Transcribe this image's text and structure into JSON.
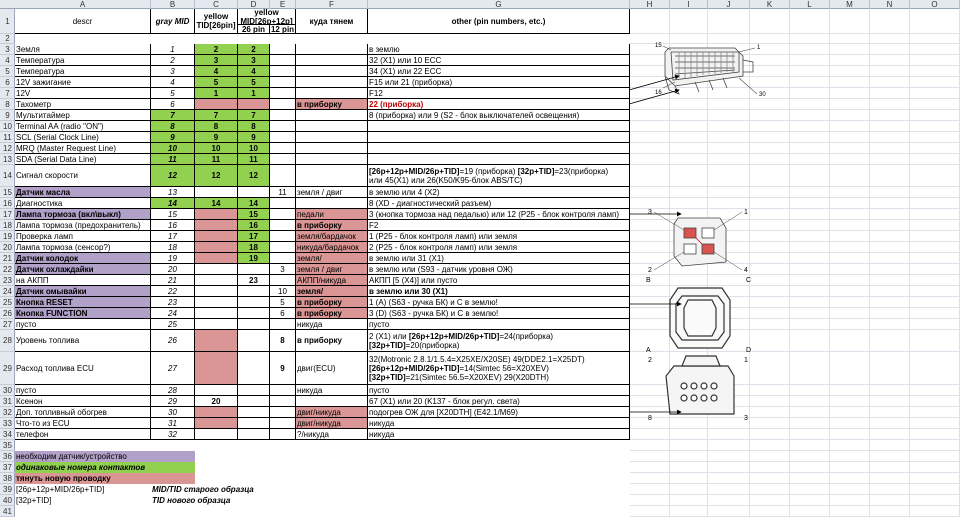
{
  "columns": [
    "A",
    "B",
    "C",
    "D",
    "E",
    "F",
    "G",
    "H",
    "I",
    "J",
    "K",
    "L",
    "M",
    "N",
    "O"
  ],
  "header": {
    "descr": "descr",
    "gray": "gray MID",
    "yellow_tid": "yellow TID[26pin]",
    "yellow_mid": "yellow MID[26p+12p]",
    "pin26": "26 pin",
    "pin12": "12 pin",
    "where": "куда тянем",
    "other": "other (pin numbers, etc.)"
  },
  "rows": [
    {
      "n": "3",
      "descr": "Земля",
      "b": "1",
      "c": "2",
      "d": "2",
      "e": "",
      "f": "",
      "g": "в землю"
    },
    {
      "n": "4",
      "descr": "Температура",
      "b": "2",
      "c": "3",
      "d": "3",
      "e": "",
      "f": "",
      "g": "32 (X1) или 10 ECC"
    },
    {
      "n": "5",
      "descr": "Температура",
      "b": "3",
      "c": "4",
      "d": "4",
      "e": "",
      "f": "",
      "g": "34 (X1) или 22 ECC"
    },
    {
      "n": "6",
      "descr": "12V зажигание",
      "b": "4",
      "c": "5",
      "d": "5",
      "e": "",
      "f": "",
      "g": "F15 или 21 (приборка)"
    },
    {
      "n": "7",
      "descr": "12V",
      "b": "5",
      "c": "1",
      "d": "1",
      "e": "",
      "f": "",
      "g": "F12"
    },
    {
      "n": "8",
      "descr": "Тахометр",
      "b": "6",
      "c": "",
      "d": "",
      "e": "",
      "f": "в приборку",
      "g": "22 (приборка)"
    },
    {
      "n": "9",
      "descr": "Мультитаймер",
      "b": "7",
      "c": "7",
      "d": "7",
      "e": "",
      "f": "",
      "g": "8 (приборка) или 9 (S2 - блок выключателей освещения)"
    },
    {
      "n": "10",
      "descr": "Terminal AA (radio \"ON\")",
      "b": "8",
      "c": "8",
      "d": "8",
      "e": "",
      "f": "",
      "g": ""
    },
    {
      "n": "11",
      "descr": "SCL (Serial Clock Line)",
      "b": "9",
      "c": "9",
      "d": "9",
      "e": "",
      "f": "",
      "g": ""
    },
    {
      "n": "12",
      "descr": "MRQ (Master Request Line)",
      "b": "10",
      "c": "10",
      "d": "10",
      "e": "",
      "f": "",
      "g": ""
    },
    {
      "n": "13",
      "descr": "SDA (Serial Data Line)",
      "b": "11",
      "c": "11",
      "d": "11",
      "e": "",
      "f": "",
      "g": ""
    },
    {
      "n": "14",
      "descr": "Сигнал скорости",
      "b": "12",
      "c": "12",
      "d": "12",
      "e": "",
      "f": "",
      "g1b": "[26p+12p+MID/26p+TID]",
      "g1": "=19 (приборка) ",
      "g1c": "[32p+TID]",
      "g1d": "=23(приборка)",
      "g2": "или 45(X1) или 26(K50/K95-блок ABS/TC)"
    },
    {
      "n": "15",
      "descr": "Датчик масла",
      "b": "13",
      "c": "",
      "d": "",
      "e": "11",
      "f": "земля / двиг",
      "g": "в землю или 4 (X2)"
    },
    {
      "n": "16",
      "descr": "Диагностика",
      "b": "14",
      "c": "14",
      "d": "14",
      "e": "",
      "f": "",
      "g": "8 (XD - диагностический разъем)"
    },
    {
      "n": "17",
      "descr": "Лампа тормоза (вкл\\выкл)",
      "b": "15",
      "c": "",
      "d": "15",
      "e": "",
      "f": "педали",
      "g": "3 (кнопка тормоза над педалью) или 12 (P25 - блок контроля ламп)"
    },
    {
      "n": "18",
      "descr": "Лампа тормоза (предохранитель)",
      "b": "16",
      "c": "",
      "d": "16",
      "e": "",
      "f": "в приборку",
      "g": "F2"
    },
    {
      "n": "19",
      "descr": "Проверка ламп",
      "b": "17",
      "c": "",
      "d": "17",
      "e": "",
      "f": "земля/бардачок",
      "g": "1 (P25 - блок контроля ламп) или земля"
    },
    {
      "n": "20",
      "descr": "Лампа тормоза (сенсор?)",
      "b": "18",
      "c": "",
      "d": "18",
      "e": "",
      "f": "никуда/бардачок",
      "g": "2 (P25 - блок контроля ламп) или земля"
    },
    {
      "n": "21",
      "descr": "Датчик колодок",
      "b": "19",
      "c": "",
      "d": "19",
      "e": "",
      "f": "земля/",
      "g": "в землю или 31 (X1)"
    },
    {
      "n": "22",
      "descr": "Датчик охлаждайки",
      "b": "20",
      "c": "",
      "d": "",
      "e": "3",
      "f": "земля / двиг",
      "g": "в землю или (S93 - датчик уровня ОЖ)"
    },
    {
      "n": "23",
      "descr": "на АКПП",
      "b": "21",
      "c": "",
      "d": "23",
      "e": "",
      "f": "АКПП/никуда",
      "g": "АКПП [5 (X4)] или пусто"
    },
    {
      "n": "24",
      "descr": "Датчик омывайки",
      "b": "22",
      "c": "",
      "d": "",
      "e": "10",
      "f": "земля/",
      "g": "в землю или 30 (X1)"
    },
    {
      "n": "25",
      "descr": "Кнопка RESET",
      "b": "23",
      "c": "",
      "d": "",
      "e": "5",
      "f": "в приборку",
      "g": "1 (A) (S63 - ручка БК) и С в землю!"
    },
    {
      "n": "26",
      "descr": "Кнопка FUNCTION",
      "b": "24",
      "c": "",
      "d": "",
      "e": "6",
      "f": "в приборку",
      "g": "3 (D) (S63 - ручка БК) и С в землю!"
    },
    {
      "n": "27",
      "descr": "пусто",
      "b": "25",
      "c": "",
      "d": "",
      "e": "",
      "f": "никуда",
      "g": "пусто"
    },
    {
      "n": "28",
      "descr": "Уровень топлива",
      "b": "26",
      "c": "",
      "d": "",
      "e": "8",
      "f": "в приборку",
      "g1": "2 (X1) или ",
      "g1b": "[26p+12p+MID/26p+TID]",
      "g1c": "=24(приборка)",
      "g2b": "[32p+TID]",
      "g2": "=20(приборка)"
    },
    {
      "n": "29",
      "descr": "Расход топлива ECU",
      "b": "27",
      "c": "",
      "d": "",
      "e": "9",
      "f": "двиг(ECU)",
      "g1": "32(Motronic 2.8.1/1.5.4=X25XE/X20SE) 49(DDE2.1=X25DT)",
      "g2b": "[26p+12p+MID/26p+TID]",
      "g2": "=14(Simtec 56=X20XEV)",
      "g3b": "[32p+TID]",
      "g3": "=21(Simtec 56.5=X20XEV) 29(X20DTH)"
    },
    {
      "n": "30",
      "descr": "пусто",
      "b": "28",
      "c": "",
      "d": "",
      "e": "",
      "f": "никуда",
      "g": "пусто"
    },
    {
      "n": "31",
      "descr": "Ксенон",
      "b": "29",
      "c": "20",
      "d": "",
      "e": "",
      "f": "",
      "g": "67 (X1) или 20 (K137 - блок регул. света)"
    },
    {
      "n": "32",
      "descr": "Доп. топливный обогрев",
      "b": "30",
      "c": "",
      "d": "",
      "e": "",
      "f": "двиг/никуда",
      "g": "подогрев ОЖ для [X20DTH] (E42.1/M69)"
    },
    {
      "n": "33",
      "descr": "Что-то из ECU",
      "b": "31",
      "c": "",
      "d": "",
      "e": "",
      "f": "двиг/никуда",
      "g": "никуда"
    },
    {
      "n": "34",
      "descr": "телефон",
      "b": "32",
      "c": "",
      "d": "",
      "e": "",
      "f": "?/никуда",
      "g": "никуда"
    }
  ],
  "legend": {
    "l36": "необходим датчик/устройство",
    "l37": "одинаковые номера контактов",
    "l38": "тянуть новую проводку",
    "l39a": "[26p+12p+MID/26p+TID]",
    "l39b": "MID/TID старого образца",
    "l40a": "[32p+TID]",
    "l40b": "TID нового образца"
  },
  "connector_labels": {
    "top_15": "15",
    "top_1": "1",
    "top_16": "16",
    "top_30": "30",
    "mid_3": "3",
    "mid_1": "1",
    "mid_2": "2",
    "mid_4": "4",
    "bot_B": "B",
    "bot_C": "C",
    "bot_A": "A",
    "bot_D": "D",
    "low_2": "2",
    "low_1": "1",
    "low_8": "8",
    "low_3": "3"
  },
  "colors": {
    "green": "#92d050",
    "purple": "#b1a0c7",
    "pink": "#da9694",
    "header": "#e4e8ef"
  }
}
